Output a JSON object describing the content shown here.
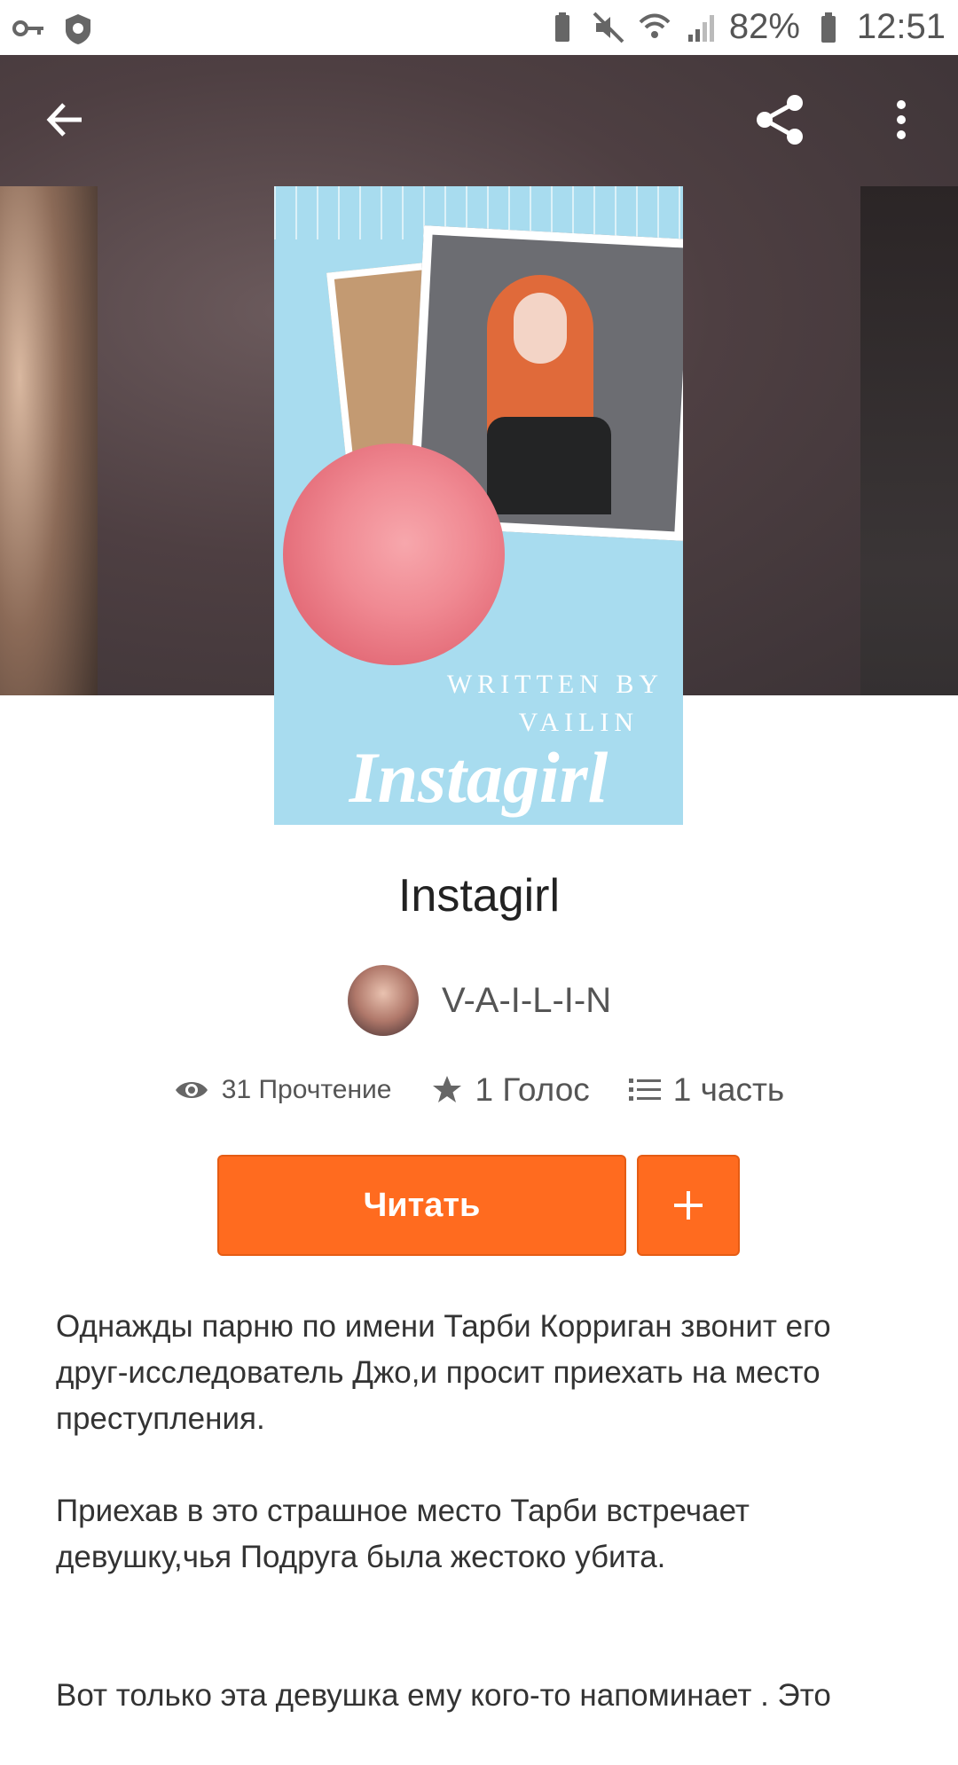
{
  "status_bar": {
    "battery_percent": "82%",
    "time": "12:51",
    "left_icons": [
      "key-icon",
      "shield-icon"
    ],
    "right_icons": [
      "battery-saver-icon",
      "mute-icon",
      "wifi-icon",
      "signal-icon",
      "battery-icon"
    ]
  },
  "toolbar": {
    "back_icon": "arrow-left-icon",
    "share_icon": "share-icon",
    "more_icon": "more-vertical-icon"
  },
  "cover": {
    "written_by_line1": "WRITTEN BY",
    "written_by_line2": "VAILIN",
    "title": "Instagirl"
  },
  "story": {
    "title": "Instagirl",
    "author": "V-A-I-L-I-N",
    "stats": {
      "reads": "31 Прочтение",
      "votes": "1 Голос",
      "parts": "1 часть"
    },
    "read_button": "Читать",
    "add_button_icon": "plus-icon",
    "description": [
      "Однажды парню по имени Тарби Корриган звонит его друг-исследователь Джо,и просит приехать на место преступления.",
      "Приехав в это страшное место Тарби встречает девушку,чья Подруга была жестоко убита.",
      "Вот только эта девушка ему кого-то напоминает . Это"
    ]
  },
  "colors": {
    "accent": "#ff6b1f",
    "text_primary": "#222222",
    "text_secondary": "#555555"
  }
}
